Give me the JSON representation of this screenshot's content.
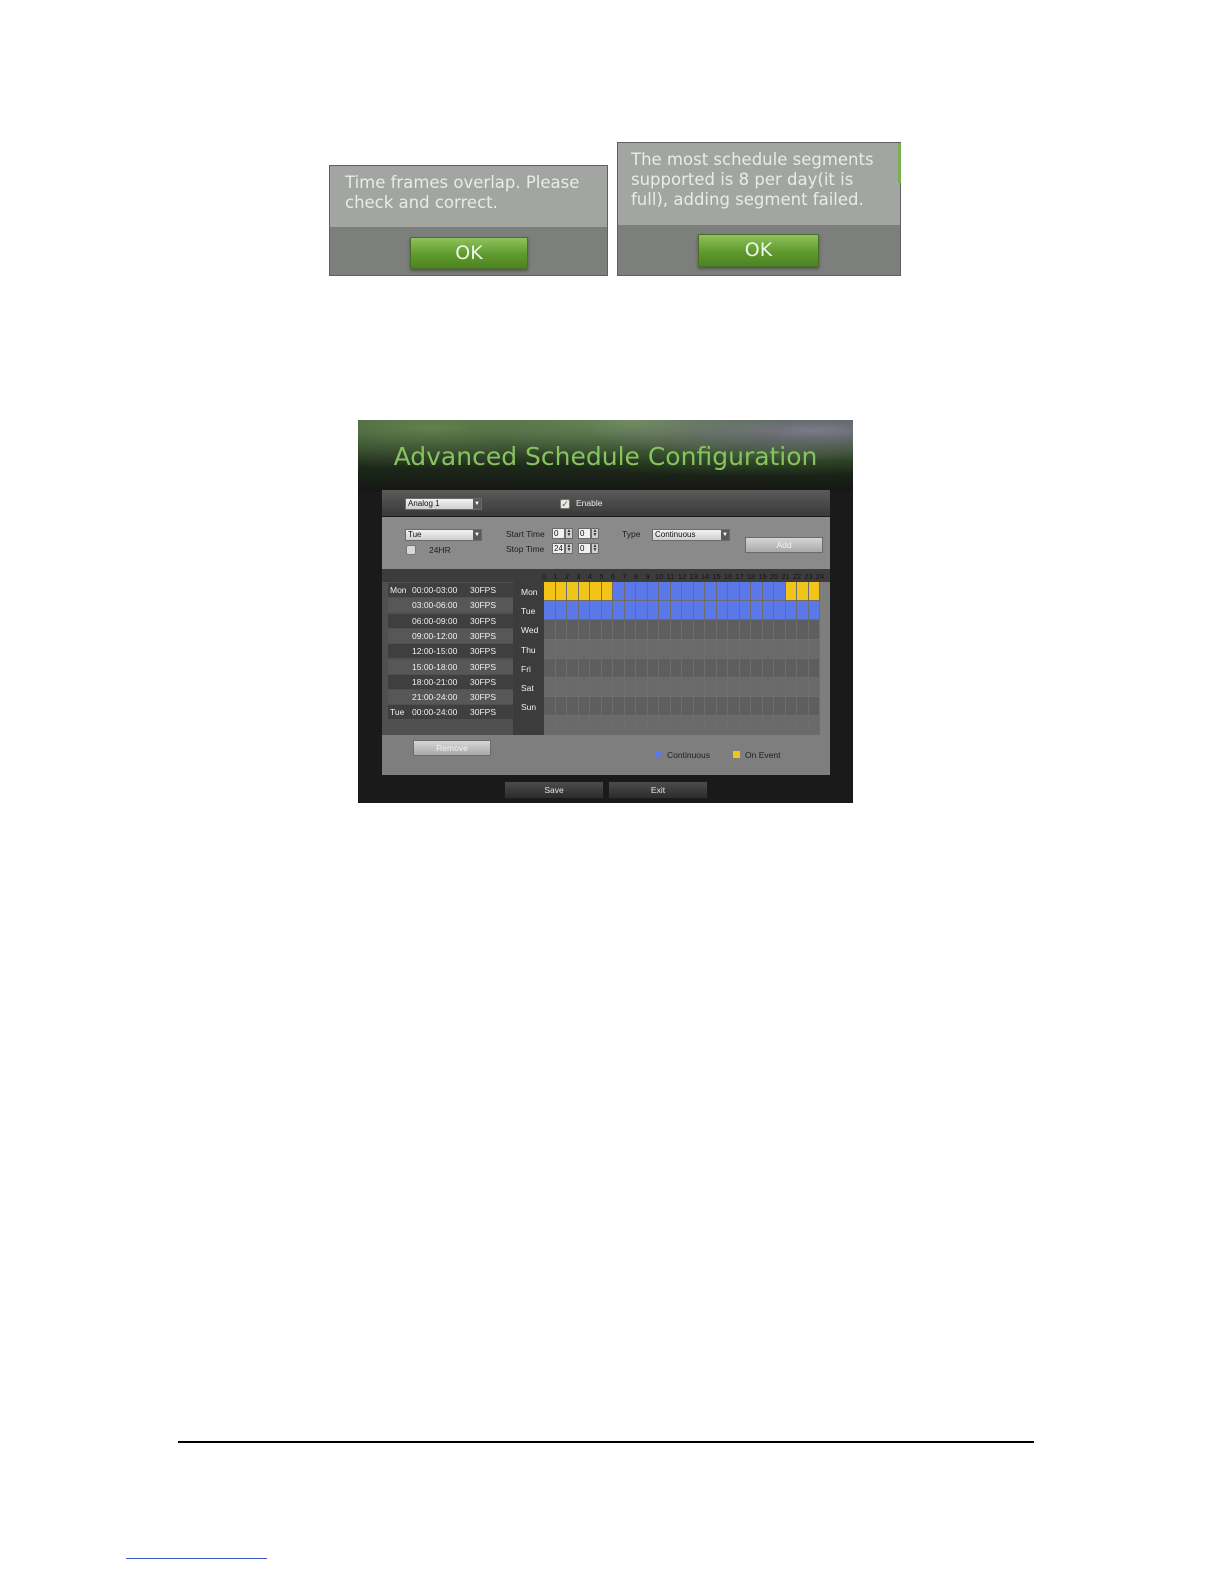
{
  "dialogs": [
    {
      "message_line1": "Time frames overlap. Please",
      "message_line2": "check and correct.",
      "ok_label": "OK"
    },
    {
      "message_line1": "The most schedule segments",
      "message_line2": "supported is 8 per day(it is",
      "message_line3": "full), adding segment failed.",
      "ok_label": "OK"
    }
  ],
  "screen": {
    "title": "Advanced Schedule Configuration",
    "camera_select": "Analog 1",
    "enable_label": "Enable",
    "enable_checked": true,
    "day_select": "Tue",
    "allday_label": "24HR",
    "start_time_label": "Start Time",
    "start_hour": "0",
    "start_min": "0",
    "stop_time_label": "Stop Time",
    "stop_hour": "24",
    "stop_min": "0",
    "type_label": "Type",
    "type_select": "Continuous",
    "add_label": "Add",
    "remove_label": "Remove",
    "save_label": "Save",
    "exit_label": "Exit",
    "segments": [
      {
        "day": "Mon",
        "range": "00:00-03:00",
        "fps": "30FPS"
      },
      {
        "day": "",
        "range": "03:00-06:00",
        "fps": "30FPS"
      },
      {
        "day": "",
        "range": "06:00-09:00",
        "fps": "30FPS"
      },
      {
        "day": "",
        "range": "09:00-12:00",
        "fps": "30FPS"
      },
      {
        "day": "",
        "range": "12:00-15:00",
        "fps": "30FPS"
      },
      {
        "day": "",
        "range": "15:00-18:00",
        "fps": "30FPS"
      },
      {
        "day": "",
        "range": "18:00-21:00",
        "fps": "30FPS"
      },
      {
        "day": "",
        "range": "21:00-24:00",
        "fps": "30FPS"
      },
      {
        "day": "Tue",
        "range": "00:00-24:00",
        "fps": "30FPS"
      }
    ],
    "hours": [
      "0",
      "1",
      "2",
      "3",
      "4",
      "5",
      "6",
      "7",
      "8",
      "9",
      "10",
      "11",
      "12",
      "13",
      "14",
      "15",
      "16",
      "17",
      "18",
      "19",
      "20",
      "21",
      "22",
      "23",
      "24"
    ],
    "days": [
      "Mon",
      "Tue",
      "Wed",
      "Thu",
      "Fri",
      "Sat",
      "Sun"
    ],
    "schedule": {
      "Mon": "EEEEEECCCCCCCCCCCCCCCEEE",
      "Tue": "CCCCCCCCCCCCCCCCCCCCCCCC",
      "Wed": "",
      "Thu": "",
      "Fri": "",
      "Sat": "",
      "Sun": ""
    },
    "legend": [
      {
        "label": "Continuous",
        "color": "#5b78e8"
      },
      {
        "label": "On Event",
        "color": "#f2c318"
      }
    ]
  }
}
